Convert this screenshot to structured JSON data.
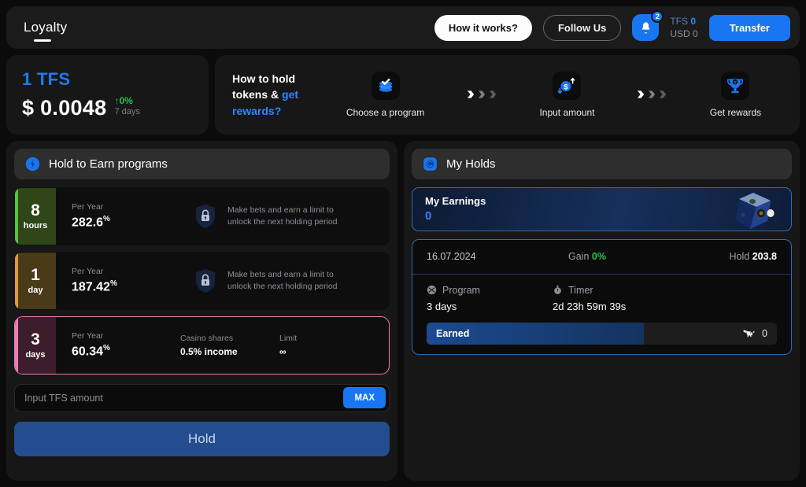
{
  "header": {
    "brand": "Loyalty",
    "how_it_works": "How it works?",
    "follow_us": "Follow Us",
    "bell_badge": "2",
    "tfs_label": "TFS",
    "tfs_value": "0",
    "usd_label": "USD 0",
    "transfer": "Transfer",
    "accent": "#1876f2"
  },
  "price": {
    "title": "1 TFS",
    "value": "$ 0.0048",
    "delta": "0%",
    "delta_arrow": "↑",
    "period": "7 days",
    "delta_color": "#27c24c"
  },
  "steps": {
    "title_line1": "How to hold",
    "title_line2": "tokens & ",
    "title_hl1": "get",
    "title_hl2": "rewards?",
    "items": [
      {
        "label": "Choose a program",
        "icon": "stack-check-icon"
      },
      {
        "label": "Input amount",
        "icon": "dollar-arrows-icon"
      },
      {
        "label": "Get rewards",
        "icon": "trophy-icon"
      }
    ]
  },
  "programs_panel": {
    "title": "Hold to Earn programs",
    "icon": "lightning-badge-icon",
    "rows": [
      {
        "num": "8",
        "unit": "hours",
        "bar_color": "#55c53c",
        "badge_bg": "#2f4618",
        "per_year_label": "Per Year",
        "per_year_value": "282.6",
        "per_year_sup": "%",
        "locked": true,
        "lock_text_line1": "Make bets and earn a limit to",
        "lock_text_line2": "unlock the next holding period"
      },
      {
        "num": "1",
        "unit": "day",
        "bar_color": "#e09a3c",
        "badge_bg": "#4a3a17",
        "per_year_label": "Per Year",
        "per_year_value": "187.42",
        "per_year_sup": "%",
        "locked": true,
        "lock_text_line1": "Make bets and earn a limit to",
        "lock_text_line2": "unlock the next holding period"
      },
      {
        "num": "3",
        "unit": "days",
        "bar_color": "#e87fae",
        "badge_bg": "#3d1c2c",
        "per_year_label": "Per Year",
        "per_year_value": "60.34",
        "per_year_sup": "%",
        "locked": false,
        "selected": true,
        "shares_label": "Casino shares",
        "shares_value": "0.5% income",
        "limit_label": "Limit",
        "limit_value": "∞"
      }
    ],
    "amount_placeholder": "Input TFS amount",
    "amount_value": "",
    "max_label": "MAX",
    "hold_label": "Hold"
  },
  "holds_panel": {
    "title": "My Holds",
    "icon": "coin-badge-icon",
    "earnings_label": "My Earnings",
    "earnings_value": "0",
    "hold_card": {
      "date": "16.07.2024",
      "gain_label": "Gain",
      "gain_value": "0%",
      "hold_label": "Hold",
      "hold_value": "203.8",
      "program_label": "Program",
      "program_value": "3 days",
      "timer_label": "Timer",
      "timer_value": "2d 23h 59m 39s",
      "earned_label": "Earned",
      "earned_value": "0",
      "earned_icon": "winged-lion-icon"
    }
  }
}
